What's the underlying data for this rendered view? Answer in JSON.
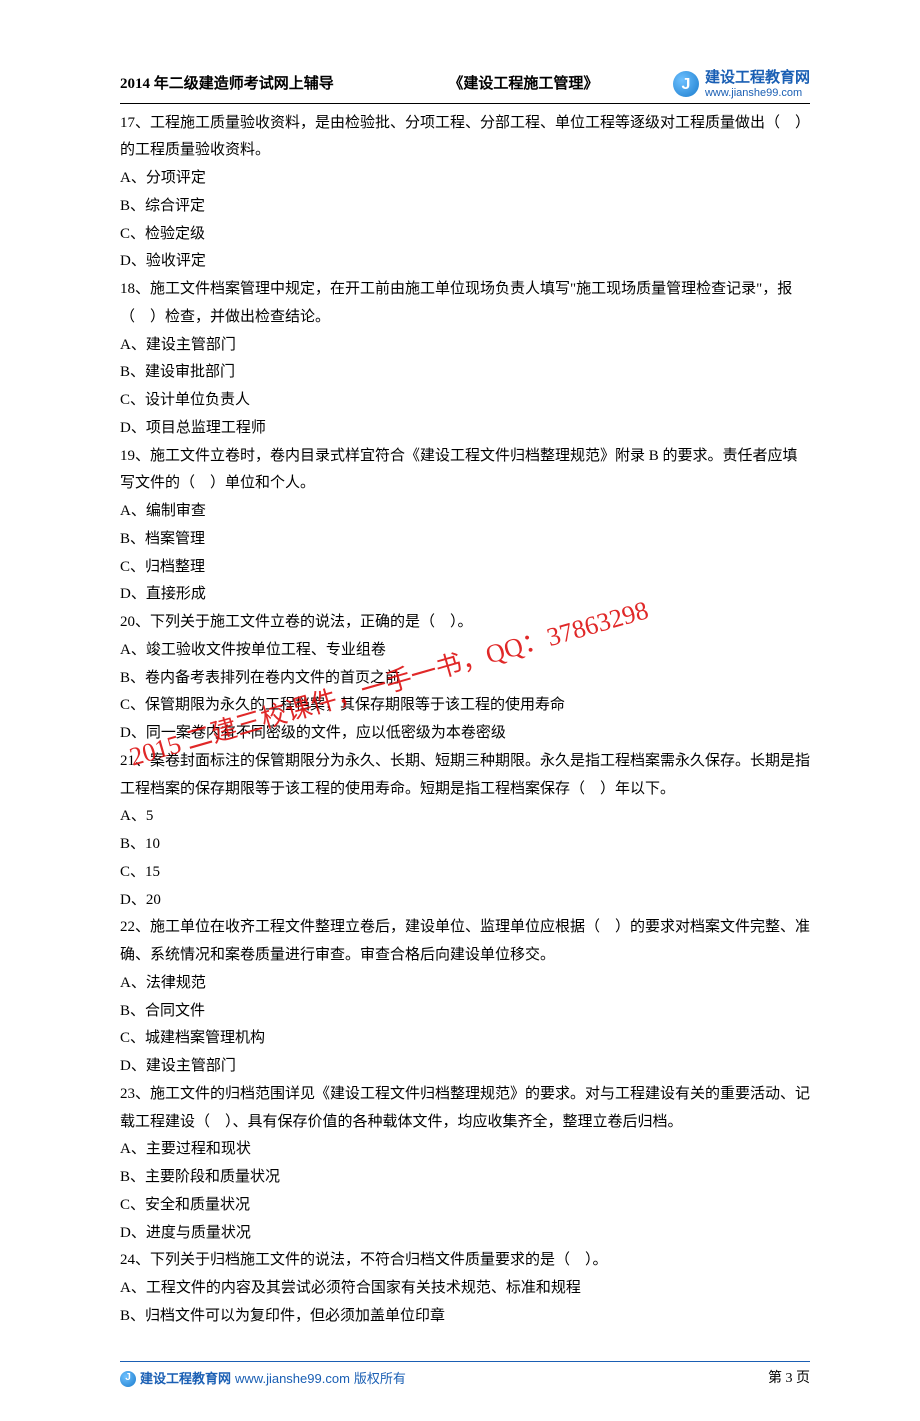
{
  "header": {
    "left": "2014 年二级建造师考试网上辅导",
    "mid": "《建设工程施工管理》",
    "logo_letter": "J",
    "logo_cn": "建设工程教育网",
    "logo_url": "www.jianshe99.com"
  },
  "watermarks": {
    "w1": "2015 二建三校课件，一手一书，QQ：37863298"
  },
  "questions": [
    {
      "stem": "17、工程施工质量验收资料，是由检验批、分项工程、分部工程、单位工程等逐级对工程质量做出（　）的工程质量验收资料。",
      "opts": [
        "A、分项评定",
        "B、综合评定",
        "C、检验定级",
        "D、验收评定"
      ]
    },
    {
      "stem": "18、施工文件档案管理中规定，在开工前由施工单位现场负责人填写\"施工现场质量管理检查记录\"，报（　）检查，并做出检查结论。",
      "opts": [
        "A、建设主管部门",
        "B、建设审批部门",
        "C、设计单位负责人",
        "D、项目总监理工程师"
      ]
    },
    {
      "stem": "19、施工文件立卷时，卷内目录式样宜符合《建设工程文件归档整理规范》附录 B 的要求。责任者应填写文件的（　）单位和个人。",
      "opts": [
        "A、编制审查",
        "B、档案管理",
        "C、归档整理",
        "D、直接形成"
      ]
    },
    {
      "stem": "20、下列关于施工文件立卷的说法，正确的是（　）。",
      "opts": [
        "A、竣工验收文件按单位工程、专业组卷",
        "B、卷内备考表排列在卷内文件的首页之前",
        "C、保管期限为永久的工程档案，其保存期限等于该工程的使用寿命",
        "D、同一案卷内有不同密级的文件，应以低密级为本卷密级"
      ]
    },
    {
      "stem": "21、案卷封面标注的保管期限分为永久、长期、短期三种期限。永久是指工程档案需永久保存。长期是指工程档案的保存期限等于该工程的使用寿命。短期是指工程档案保存（　）年以下。",
      "opts": [
        "A、5",
        "B、10",
        "C、15",
        "D、20"
      ]
    },
    {
      "stem": "22、施工单位在收齐工程文件整理立卷后，建设单位、监理单位应根据（　）的要求对档案文件完整、准确、系统情况和案卷质量进行审查。审查合格后向建设单位移交。",
      "opts": [
        "A、法律规范",
        "B、合同文件",
        "C、城建档案管理机构",
        "D、建设主管部门"
      ]
    },
    {
      "stem": "23、施工文件的归档范围详见《建设工程文件归档整理规范》的要求。对与工程建设有关的重要活动、记载工程建设（　）、具有保存价值的各种载体文件，均应收集齐全，整理立卷后归档。",
      "opts": [
        "A、主要过程和现状",
        "B、主要阶段和质量状况",
        "C、安全和质量状况",
        "D、进度与质量状况"
      ]
    },
    {
      "stem": "24、下列关于归档施工文件的说法，不符合归档文件质量要求的是（　）。",
      "opts": [
        "A、工程文件的内容及其尝试必须符合国家有关技术规范、标准和规程",
        "B、归档文件可以为复印件，但必须加盖单位印章"
      ]
    }
  ],
  "footer": {
    "brand": "建设工程教育网",
    "url": "www.jianshe99.com",
    "copy": "版权所有",
    "page": "第 3 页"
  }
}
